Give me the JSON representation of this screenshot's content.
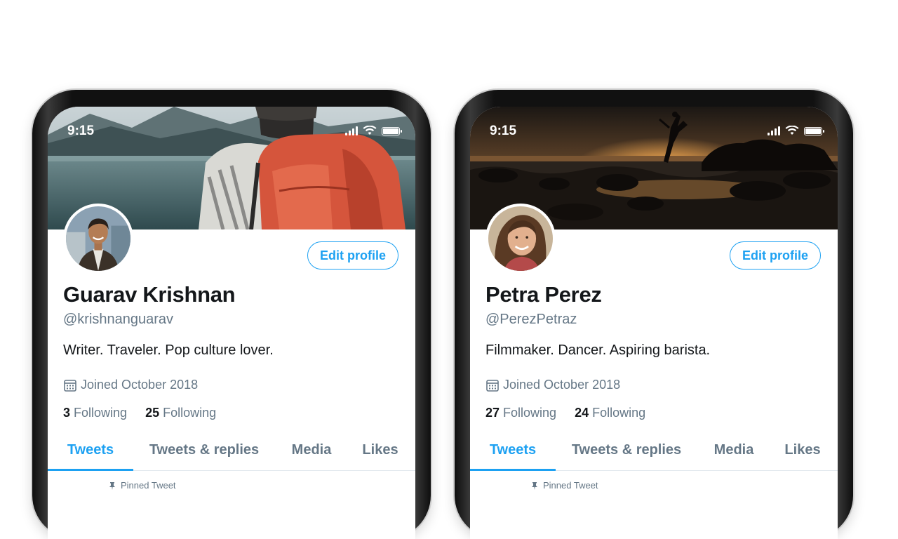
{
  "colors": {
    "accent": "#1da1f2",
    "text_primary": "#14171a",
    "text_secondary": "#657786"
  },
  "profiles": [
    {
      "status_time": "9:15",
      "banner": "hiker-with-red-backpack-at-lake",
      "avatar": "smiling-man-outdoors",
      "edit_label": "Edit profile",
      "name": "Guarav Krishnan",
      "handle": "@krishnanguarav",
      "bio": "Writer. Traveler. Pop culture lover.",
      "joined": "Joined October 2018",
      "following_1_count": "3",
      "following_1_label": "Following",
      "following_2_count": "25",
      "following_2_label": "Following",
      "tabs": [
        "Tweets",
        "Tweets & replies",
        "Media",
        "Likes"
      ],
      "active_tab": "Tweets",
      "pinned_label": "Pinned Tweet"
    },
    {
      "status_time": "9:15",
      "banner": "dancer-silhouette-at-sunset-beach",
      "avatar": "smiling-woman-curly-hair",
      "edit_label": "Edit profile",
      "name": "Petra Perez",
      "handle": "@PerezPetraz",
      "bio": "Filmmaker. Dancer. Aspiring barista.",
      "joined": "Joined October 2018",
      "following_1_count": "27",
      "following_1_label": "Following",
      "following_2_count": "24",
      "following_2_label": "Following",
      "tabs": [
        "Tweets",
        "Tweets & replies",
        "Media",
        "Likes"
      ],
      "active_tab": "Tweets",
      "pinned_label": "Pinned Tweet"
    }
  ]
}
